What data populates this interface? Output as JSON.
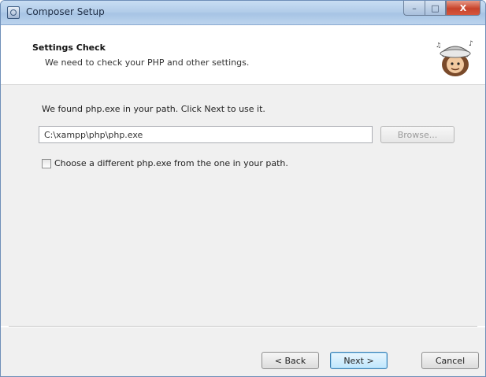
{
  "window": {
    "title": "Composer Setup",
    "controls": {
      "minimize": "–",
      "maximize": "□",
      "close": "X"
    }
  },
  "header": {
    "title": "Settings Check",
    "subtitle": "We need to check your PHP and other settings."
  },
  "main": {
    "found_text": "We found php.exe in your path. Click Next to use it.",
    "php_path": "C:\\xampp\\php\\php.exe",
    "browse_label": "Browse...",
    "checkbox_label": "Choose a different php.exe from the one in your path.",
    "checkbox_checked": false
  },
  "footer": {
    "back_label": "< Back",
    "next_label": "Next >",
    "cancel_label": "Cancel"
  },
  "colors": {
    "titlebar": "#b3cde9",
    "body_bg": "#f0f0f0",
    "close_button": "#c7432b",
    "default_button_border": "#3c7fb1"
  },
  "icons": {
    "app": "composer-installer-icon",
    "logo": "composer-conductor-logo"
  }
}
